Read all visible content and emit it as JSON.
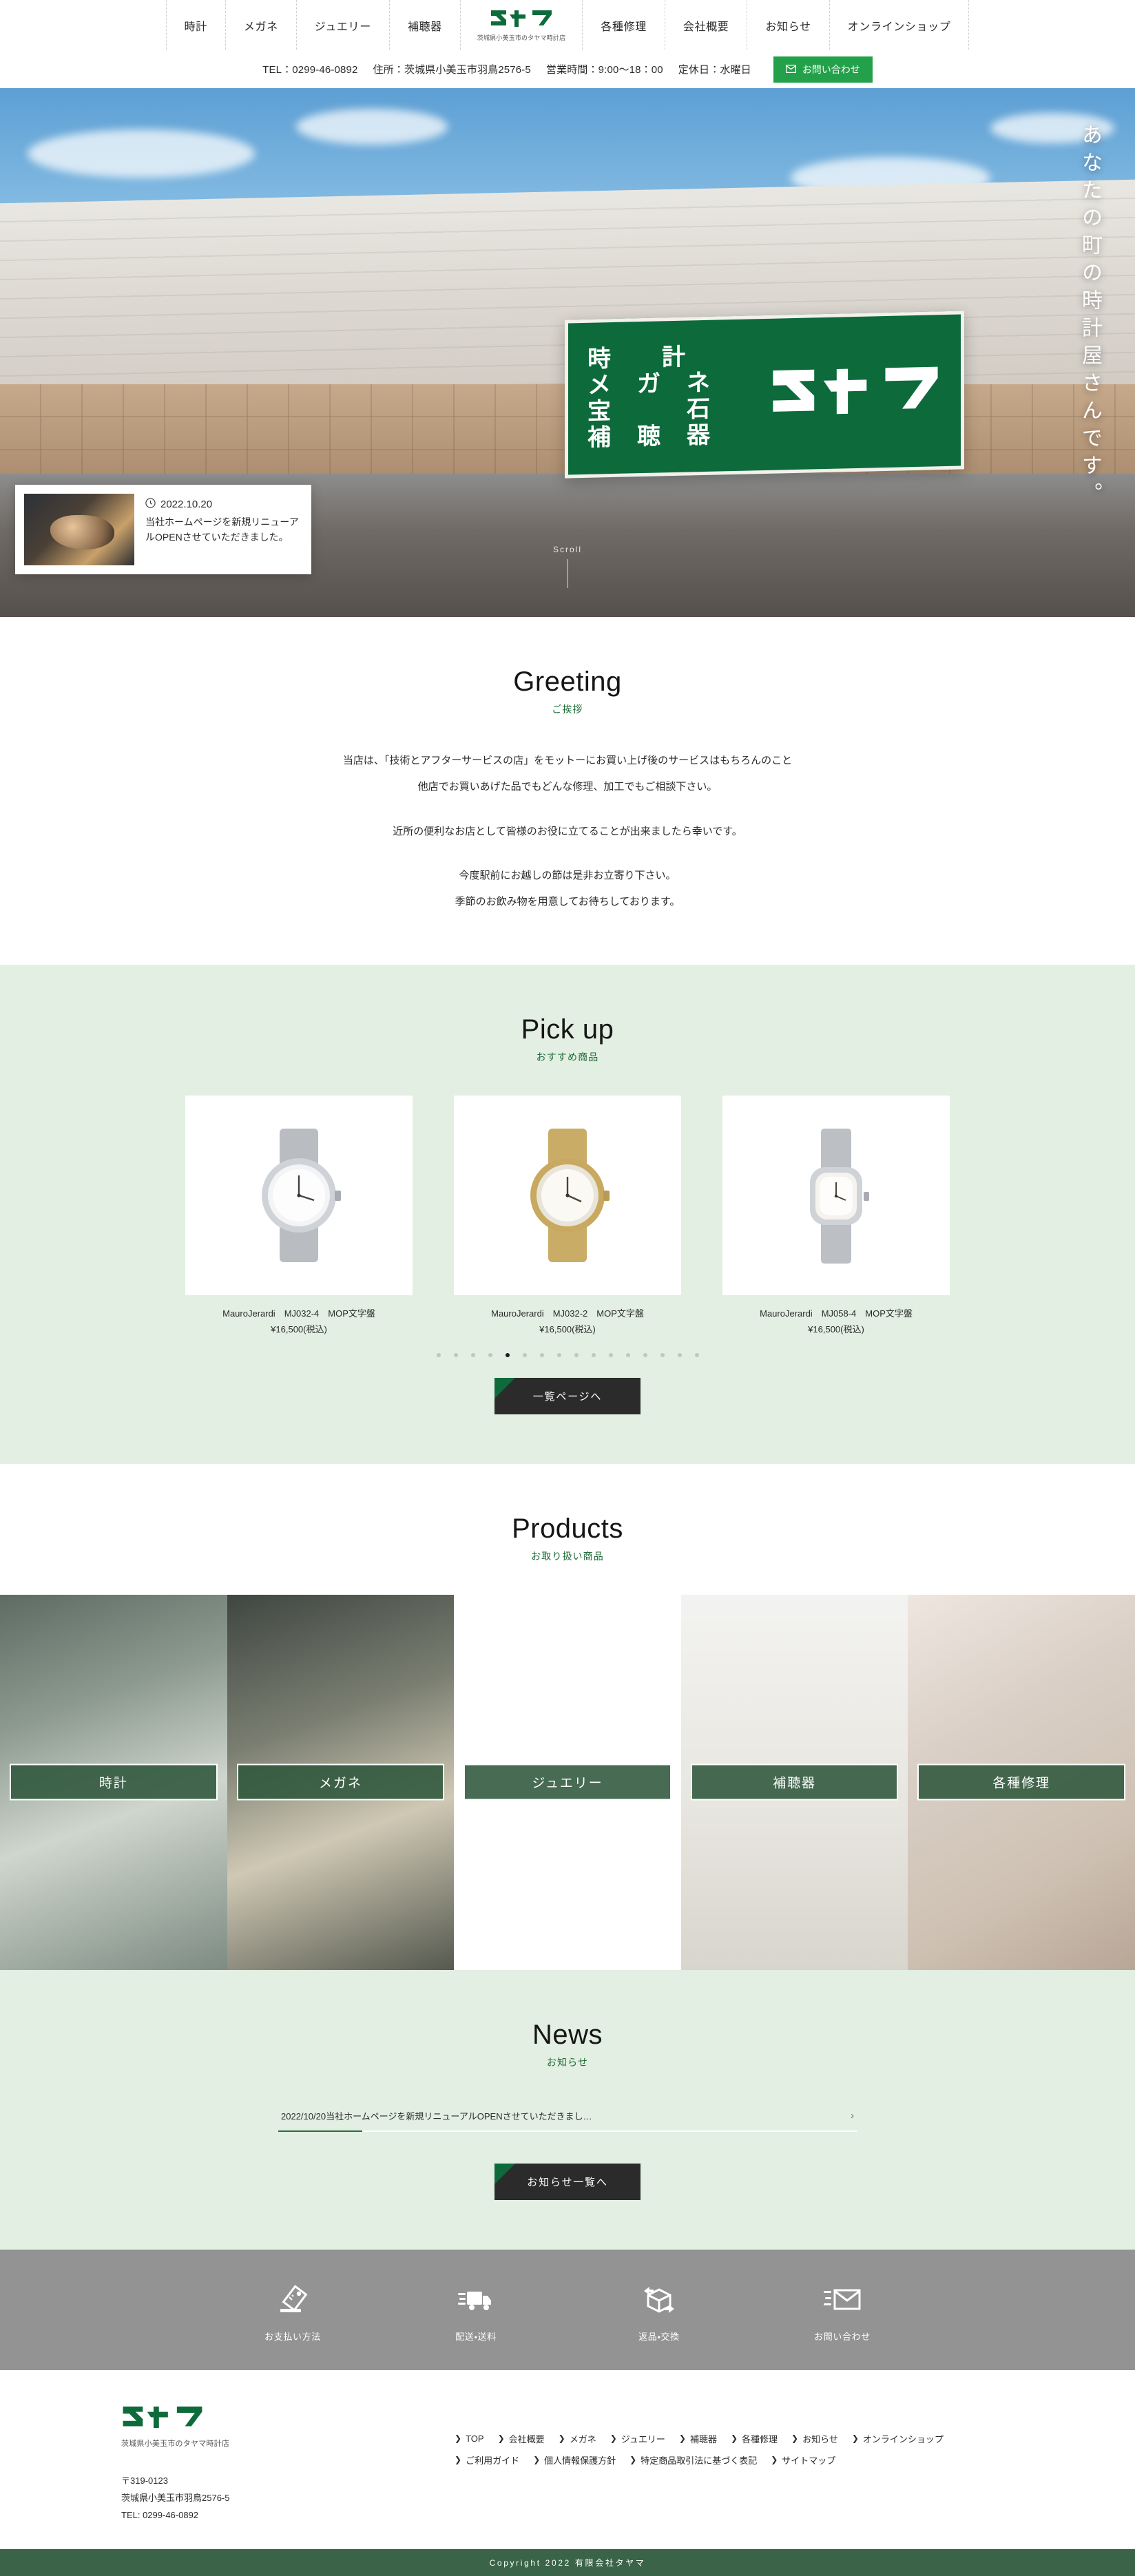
{
  "header": {
    "nav_left": [
      {
        "label": "時計"
      },
      {
        "label": "メガネ"
      },
      {
        "label": "ジュエリー"
      },
      {
        "label": "補聴器"
      }
    ],
    "logo": {
      "mark": "タヤマ",
      "sub": "茨城県小美玉市のタヤマ時計店"
    },
    "nav_right": [
      {
        "label": "各種修理"
      },
      {
        "label": "会社概要"
      },
      {
        "label": "お知らせ"
      },
      {
        "label": "オンラインショップ"
      }
    ]
  },
  "infobar": {
    "tel": "TEL：0299-46-0892",
    "address": "住所：茨城県小美玉市羽鳥2576-5",
    "hours": "営業時間：9:00〜18：00",
    "holiday": "定休日：水曜日",
    "contact_button": "お問い合わせ",
    "contact_icon": "mail-icon",
    "contact_color": "#23a14a"
  },
  "hero": {
    "vertical_text": "あなたの町の時計屋さんです。",
    "scroll_label": "Scroll",
    "sign": {
      "col1": "時",
      "col2": "計",
      "col3": "メ",
      "col4": "ガ",
      "col5": "宝",
      "col6": "ネ",
      "col7": "補聴器",
      "col8": "石",
      "logo": "タヤマ"
    },
    "sign_lines": [
      "時　　計",
      "メ　ガ　ネ",
      "宝　　　石",
      "補　聴　器"
    ],
    "news_card": {
      "date": "2022.10.20",
      "date_icon": "clock-icon",
      "text": "当社ホームページを新規リニューアルOPENさせていただきました。"
    }
  },
  "greeting": {
    "title_en": "Greeting",
    "title_ja": "ご挨拶",
    "lines": [
      "当店は、「技術とアフターサービスの店」をモットーにお買い上げ後のサービスはもちろんのこと",
      "他店でお買いあげた品でもどんな修理、加工でもご相談下さい。",
      "近所の便利なお店として皆様のお役に立てることが出来ましたら幸いです。",
      "今度駅前にお越しの節は是非お立寄り下さい。",
      "季節のお飲み物を用意してお待ちしております。"
    ]
  },
  "pickup": {
    "title_en": "Pick up",
    "title_ja": "おすすめ商品",
    "items": [
      {
        "name": "MauroJerardi　MJ032-4　MOP文字盤",
        "price": "¥16,500(税込)",
        "image": "silver-watch"
      },
      {
        "name": "MauroJerardi　MJ032-2　MOP文字盤",
        "price": "¥16,500(税込)",
        "image": "gold-silver-watch"
      },
      {
        "name": "MauroJerardi　MJ058-4　MOP文字盤",
        "price": "¥16,500(税込)",
        "image": "square-watch"
      }
    ],
    "dot_count": 16,
    "active_dot": 4,
    "button": "一覧ページへ"
  },
  "products": {
    "title_en": "Products",
    "title_ja": "お取り扱い商品",
    "tiles": [
      {
        "label": "時計"
      },
      {
        "label": "メガネ"
      },
      {
        "label": "ジュエリー"
      },
      {
        "label": "補聴器"
      },
      {
        "label": "各種修理"
      }
    ]
  },
  "news": {
    "title_en": "News",
    "title_ja": "お知らせ",
    "items": [
      {
        "text": "2022/10/20当社ホームページを新規リニューアルOPENさせていただきまし…",
        "chevron": "›"
      }
    ],
    "button": "お知らせ一覧へ"
  },
  "services": [
    {
      "label": "お支払い方法",
      "icon": "price-tag-icon"
    },
    {
      "label": "配送・送料",
      "icon": "truck-icon"
    },
    {
      "label": "返品・交換",
      "icon": "return-box-icon"
    },
    {
      "label": "お問い合わせ",
      "icon": "envelope-icon"
    }
  ],
  "footer": {
    "logo_mark": "タヤマ",
    "logo_sub": "茨城県小美玉市のタヤマ時計店",
    "postal": "〒319-0123",
    "address": "茨城県小美玉市羽鳥2576-5",
    "tel": "TEL: 0299-46-0892",
    "links_row1": [
      {
        "label": "TOP"
      },
      {
        "label": "会社概要"
      },
      {
        "label": "メガネ"
      },
      {
        "label": "ジュエリー"
      },
      {
        "label": "補聴器"
      },
      {
        "label": "各種修理"
      },
      {
        "label": "お知らせ"
      },
      {
        "label": "オンラインショップ"
      }
    ],
    "links_row2": [
      {
        "label": "ご利用ガイド"
      },
      {
        "label": "個人情報保護方針"
      },
      {
        "label": "特定商品取引法に基づく表記"
      },
      {
        "label": "サイトマップ"
      }
    ],
    "copyright": "Copyright 2022 有限会社タヤマ"
  },
  "colors": {
    "brand_green": "#0d6b3b",
    "accent_green": "#23a14a",
    "band_green": "#e2efe2",
    "footer_green": "#3a6348",
    "service_gray": "#939393"
  }
}
